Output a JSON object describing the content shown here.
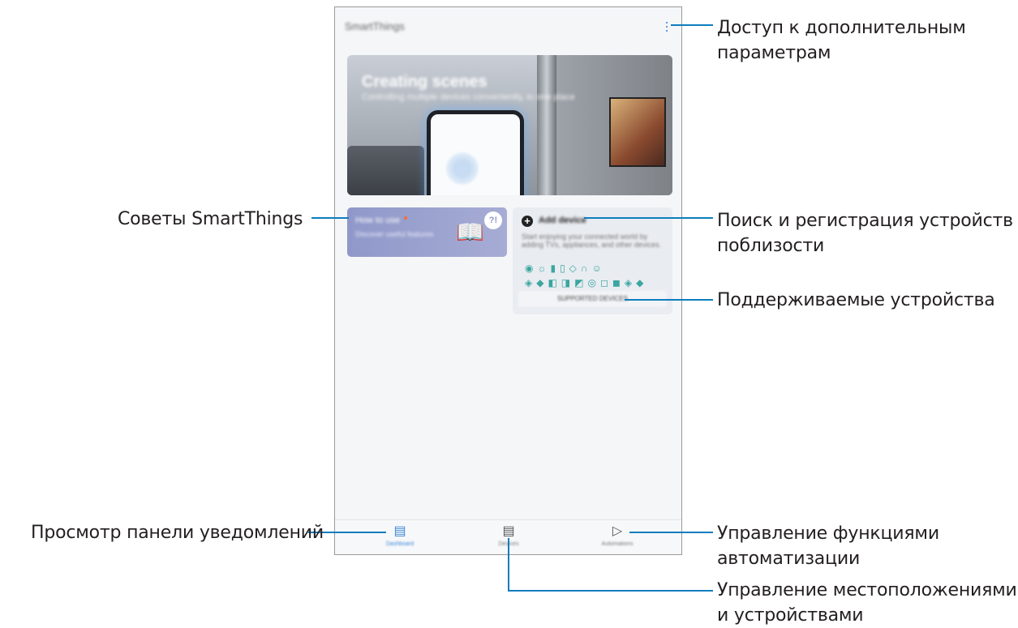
{
  "app": {
    "title": "SmartThings",
    "banner": {
      "title": "Creating scenes",
      "subtitle": "Controlling multiple devices conveniently, in one place"
    },
    "tips_card": {
      "title": "How to use",
      "subtitle": "Discover useful features",
      "bubble": "?!"
    },
    "add_device_card": {
      "title": "Add device",
      "description": "Start enjoying your connected world by adding TVs, appliances, and other devices.",
      "icons": "◉☼▮▯◇∩☺◈◆◧◨◩◎◻◼◈◆",
      "supported_button": "SUPPORTED DEVICES"
    },
    "nav": {
      "dashboard_label": "Dashboard",
      "devices_label": "Devices",
      "automations_label": "Automations"
    }
  },
  "callouts": {
    "more_options": "Доступ к дополнительным\nпараметрам",
    "tips": "Советы SmartThings",
    "search_register": "Поиск и регистрация устройств\nпоблизости",
    "supported_devices": "Поддерживаемые устройства",
    "dashboard": "Просмотр панели уведомлений",
    "automations": "Управление функциями\nавтоматизации",
    "locations_devices": "Управление местоположениями\nи устройствами"
  },
  "colors": {
    "accent": "#0d7dbf",
    "nav_active": "#3a86d6"
  }
}
